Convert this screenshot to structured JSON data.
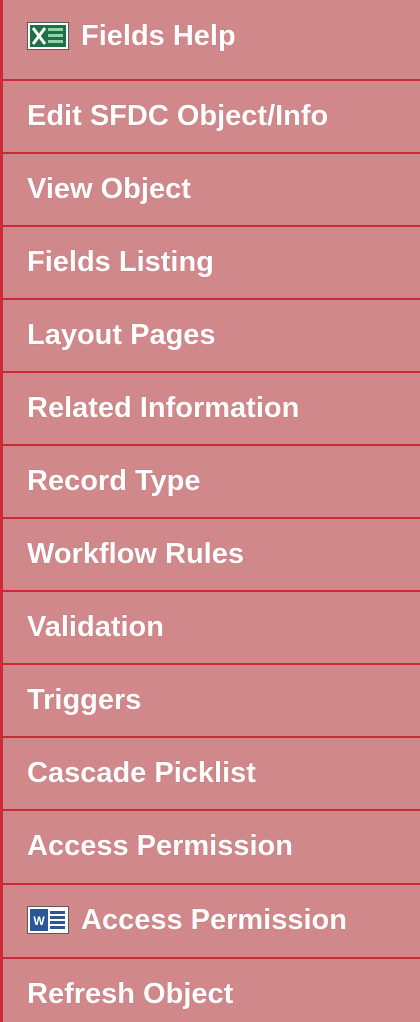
{
  "menu": {
    "items": [
      {
        "label": "Fields Help",
        "icon": "excel-icon"
      },
      {
        "label": "Edit SFDC Object/Info"
      },
      {
        "label": "View Object"
      },
      {
        "label": "Fields Listing"
      },
      {
        "label": "Layout Pages"
      },
      {
        "label": "Related Information"
      },
      {
        "label": "Record Type"
      },
      {
        "label": "Workflow Rules"
      },
      {
        "label": "Validation"
      },
      {
        "label": "Triggers"
      },
      {
        "label": "Cascade Picklist"
      },
      {
        "label": "Access Permission"
      },
      {
        "label": "Access Permission",
        "icon": "word-icon"
      },
      {
        "label": "Refresh Object"
      }
    ]
  },
  "colors": {
    "item_background": "#d1888b",
    "separator": "#cc2a39",
    "text": "#ffffff",
    "excel_icon": "#1e7145",
    "word_icon": "#2b5797"
  }
}
